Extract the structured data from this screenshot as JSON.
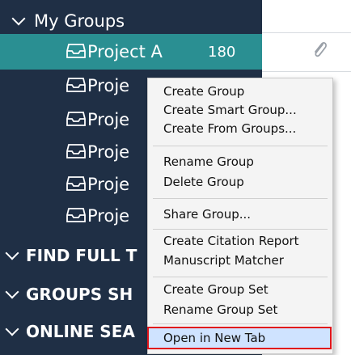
{
  "sidebar": {
    "group_header": "My Groups",
    "selected_item": {
      "label": "Project A",
      "count": "180"
    },
    "other_items": [
      "Proje",
      "Proje",
      "Proje",
      "Proje",
      "Proje"
    ],
    "sections": [
      "FIND FULL T",
      "GROUPS SH",
      "ONLINE SEA"
    ]
  },
  "icons": {
    "group": "tray-icon",
    "expand": "chevron-down-icon",
    "attachment": "paperclip-icon"
  },
  "context_menu": {
    "items": [
      "Create Group",
      "Create Smart Group...",
      "Create From Groups...",
      "Rename Group",
      "Delete Group",
      "Share Group...",
      "Create Citation Report",
      "Manuscript Matcher",
      "Create Group Set",
      "Rename Group Set",
      "Open in New Tab"
    ]
  },
  "colors": {
    "sidebar_bg": "#1f2f45",
    "selected_bg": "#2a8f92",
    "highlight_border": "#e0151b"
  }
}
